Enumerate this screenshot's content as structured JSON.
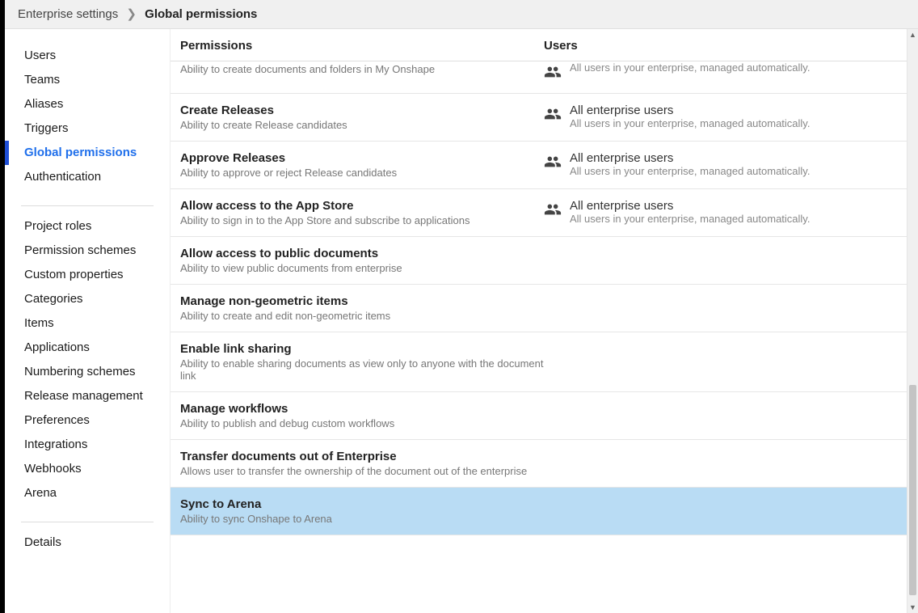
{
  "breadcrumb": {
    "root": "Enterprise settings",
    "current": "Global permissions"
  },
  "sidebar": {
    "group1": [
      {
        "label": "Users"
      },
      {
        "label": "Teams"
      },
      {
        "label": "Aliases"
      },
      {
        "label": "Triggers"
      },
      {
        "label": "Global permissions",
        "active": true
      },
      {
        "label": "Authentication"
      }
    ],
    "group2": [
      {
        "label": "Project roles"
      },
      {
        "label": "Permission schemes"
      },
      {
        "label": "Custom properties"
      },
      {
        "label": "Categories"
      },
      {
        "label": "Items"
      },
      {
        "label": "Applications"
      },
      {
        "label": "Numbering schemes"
      },
      {
        "label": "Release management"
      },
      {
        "label": "Preferences"
      },
      {
        "label": "Integrations"
      },
      {
        "label": "Webhooks"
      },
      {
        "label": "Arena"
      }
    ],
    "group3": [
      {
        "label": "Details"
      }
    ]
  },
  "headers": {
    "permissions": "Permissions",
    "users": "Users"
  },
  "usersCommon": {
    "title": "All enterprise users",
    "desc": "All users in your enterprise, managed automatically."
  },
  "permissions": [
    {
      "title": "",
      "desc": "Ability to create documents and folders in My Onshape",
      "hasUsers": true,
      "partial": true
    },
    {
      "title": "Create Releases",
      "desc": "Ability to create Release candidates",
      "hasUsers": true
    },
    {
      "title": "Approve Releases",
      "desc": "Ability to approve or reject Release candidates",
      "hasUsers": true
    },
    {
      "title": "Allow access to the App Store",
      "desc": "Ability to sign in to the App Store and subscribe to applications",
      "hasUsers": true
    },
    {
      "title": "Allow access to public documents",
      "desc": "Ability to view public documents from enterprise",
      "hasUsers": false
    },
    {
      "title": "Manage non-geometric items",
      "desc": "Ability to create and edit non-geometric items",
      "hasUsers": false
    },
    {
      "title": "Enable link sharing",
      "desc": "Ability to enable sharing documents as view only to anyone with the document link",
      "hasUsers": false
    },
    {
      "title": "Manage workflows",
      "desc": "Ability to publish and debug custom workflows",
      "hasUsers": false
    },
    {
      "title": "Transfer documents out of Enterprise",
      "desc": "Allows user to transfer the ownership of the document out of the enterprise",
      "hasUsers": false
    },
    {
      "title": "Sync to Arena",
      "desc": "Ability to sync Onshape to Arena",
      "hasUsers": false,
      "highlight": true
    }
  ]
}
